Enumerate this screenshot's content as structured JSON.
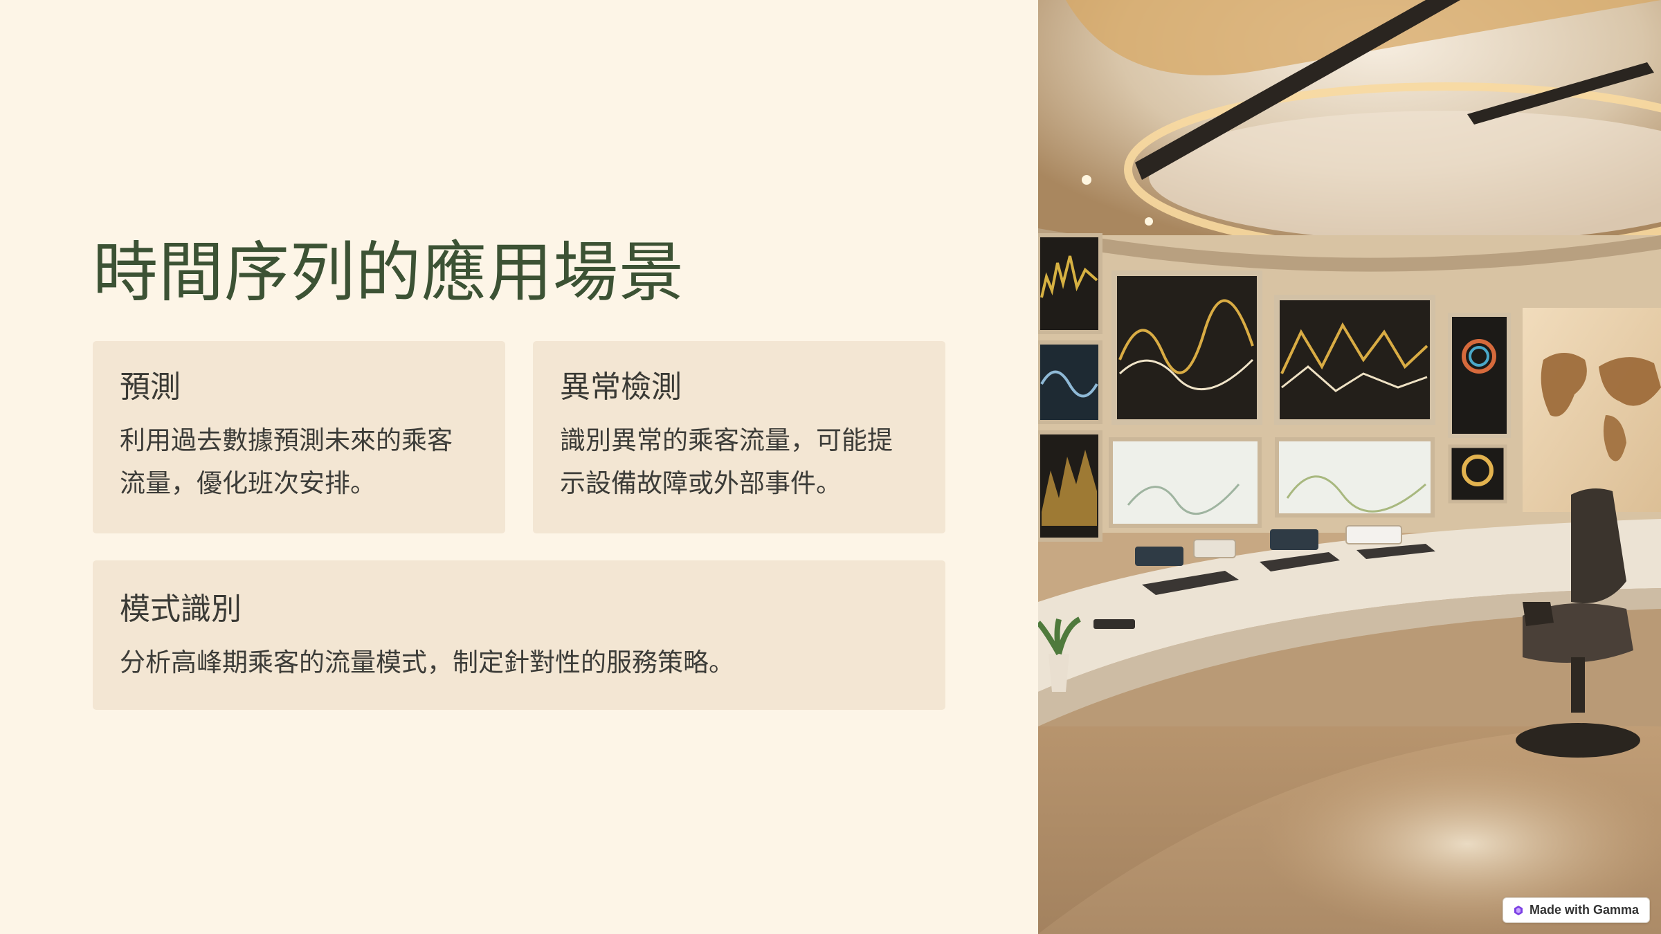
{
  "slide": {
    "title": "時間序列的應用場景",
    "cards": [
      {
        "heading": "預測",
        "body": "利用過去數據預測未來的乘客流量，優化班次安排。"
      },
      {
        "heading": "異常檢測",
        "body": "識別異常的乘客流量，可能提示設備故障或外部事件。"
      },
      {
        "heading": "模式識別",
        "body": "分析高峰期乘客的流量模式，制定針對性的服務策略。"
      }
    ]
  },
  "image": {
    "description": "control-room-photo",
    "colors": {
      "wall": "#d9c4a5",
      "screen": "#2a2720",
      "graph": "#d2a94a",
      "desk": "#e6dccb",
      "floor": "#a57a50"
    }
  },
  "badge": {
    "label": "Made with Gamma",
    "icon": "gamma-logo-icon"
  },
  "colors": {
    "background": "#fdf5e7",
    "card": "#f3e6d3",
    "title": "#3c5234",
    "text": "#3c3c38"
  }
}
